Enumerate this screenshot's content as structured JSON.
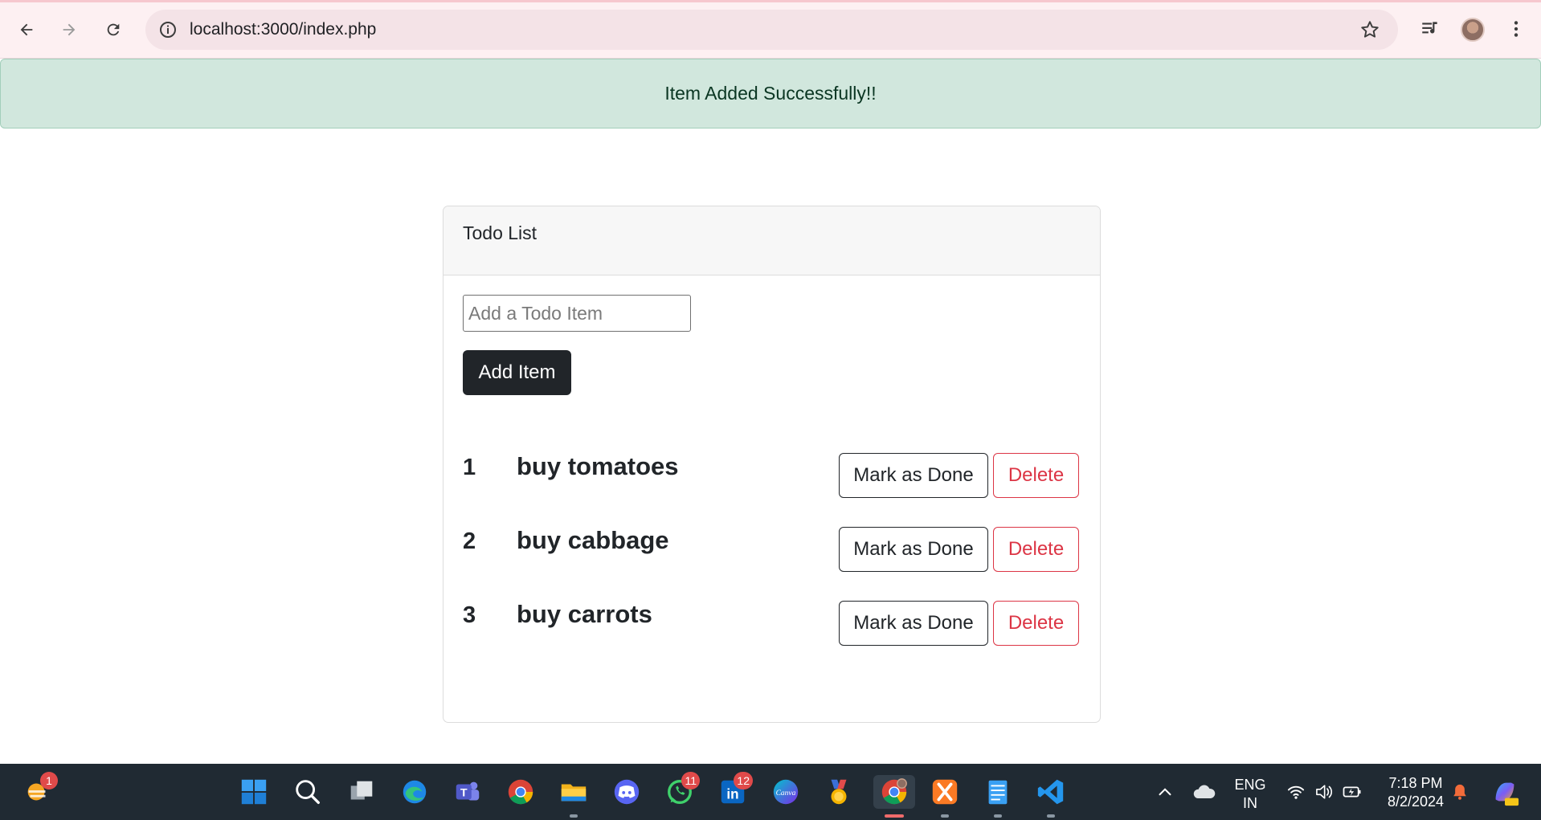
{
  "browser": {
    "url": "localhost:3000/index.php"
  },
  "alert": {
    "message": "Item Added Successfully!!"
  },
  "card": {
    "title": "Todo List",
    "input_value": "",
    "input_placeholder": "Add a Todo Item",
    "add_button_label": "Add Item",
    "items": [
      {
        "number": "1",
        "text": "buy tomatoes",
        "done_label": "Mark as Done",
        "delete_label": "Delete"
      },
      {
        "number": "2",
        "text": "buy cabbage",
        "done_label": "Mark as Done",
        "delete_label": "Delete"
      },
      {
        "number": "3",
        "text": "buy carrots",
        "done_label": "Mark as Done",
        "delete_label": "Delete"
      }
    ]
  },
  "taskbar": {
    "weather_badge": "1",
    "whatsapp_badge": "11",
    "linkedin_badge": "12",
    "apps": [
      "windows-start",
      "search",
      "task-view",
      "edge",
      "teams",
      "chrome",
      "file-explorer",
      "discord",
      "whatsapp",
      "linkedin",
      "canva",
      "medal",
      "chrome-active",
      "xampp",
      "notepad",
      "vscode"
    ],
    "language_top": "ENG",
    "language_bottom": "IN",
    "time": "7:18 PM",
    "date": "8/2/2024"
  },
  "colors": {
    "alert_bg": "#d1e7dd",
    "alert_text": "#0a3622",
    "primary_dark": "#212529",
    "danger": "#dc3545",
    "taskbar_bg": "#202a33"
  }
}
